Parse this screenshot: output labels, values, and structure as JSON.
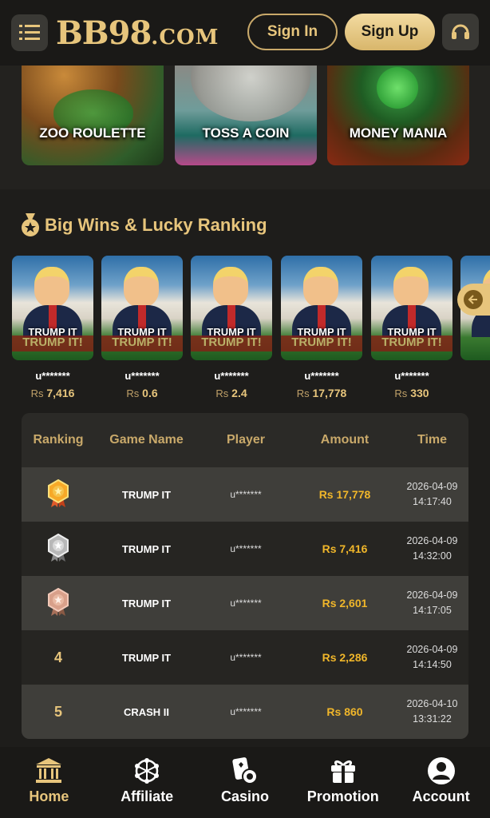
{
  "header": {
    "logo_main": "BB98",
    "logo_suffix": ".COM",
    "signin_label": "Sign In",
    "signup_label": "Sign Up"
  },
  "games": [
    {
      "title": "ZOO ROULETTE"
    },
    {
      "title": "TOSS A COIN"
    },
    {
      "title": "MONEY MANIA"
    }
  ],
  "section": {
    "title": "Big Wins & Lucky Ranking"
  },
  "big_wins": [
    {
      "game": "TRUMP IT",
      "banner": "TRUMP IT!",
      "user": "u*******",
      "currency": "Rs",
      "amount": "7,416"
    },
    {
      "game": "TRUMP IT",
      "banner": "TRUMP IT!",
      "user": "u*******",
      "currency": "Rs",
      "amount": "0.6"
    },
    {
      "game": "TRUMP IT",
      "banner": "TRUMP IT!",
      "user": "u*******",
      "currency": "Rs",
      "amount": "2.4"
    },
    {
      "game": "TRUMP IT",
      "banner": "TRUMP IT!",
      "user": "u*******",
      "currency": "Rs",
      "amount": "17,778"
    },
    {
      "game": "TRUMP IT",
      "banner": "TRUMP IT!",
      "user": "u*******",
      "currency": "Rs",
      "amount": "330"
    }
  ],
  "ranking": {
    "headers": [
      "Ranking",
      "Game Name",
      "Player",
      "Amount",
      "Time"
    ],
    "rows": [
      {
        "rank": "1",
        "medal": "gold",
        "game": "TRUMP IT",
        "player": "u*******",
        "amount": "Rs 17,778",
        "date": "2026-04-09",
        "time": "14:17:40"
      },
      {
        "rank": "2",
        "medal": "silver",
        "game": "TRUMP IT",
        "player": "u*******",
        "amount": "Rs 7,416",
        "date": "2026-04-09",
        "time": "14:32:00"
      },
      {
        "rank": "3",
        "medal": "bronze",
        "game": "TRUMP IT",
        "player": "u*******",
        "amount": "Rs 2,601",
        "date": "2026-04-09",
        "time": "14:17:05"
      },
      {
        "rank": "4",
        "medal": "",
        "game": "TRUMP IT",
        "player": "u*******",
        "amount": "Rs 2,286",
        "date": "2026-04-09",
        "time": "14:14:50"
      },
      {
        "rank": "5",
        "medal": "",
        "game": "CRASH II",
        "player": "u*******",
        "amount": "Rs 860",
        "date": "2026-04-10",
        "time": "13:31:22"
      }
    ]
  },
  "bottom_nav": [
    {
      "label": "Home",
      "icon": "bank-icon",
      "active": true
    },
    {
      "label": "Affiliate",
      "icon": "network-icon",
      "active": false
    },
    {
      "label": "Casino",
      "icon": "cards-chip-icon",
      "active": false
    },
    {
      "label": "Promotion",
      "icon": "gift-icon",
      "active": false
    },
    {
      "label": "Account",
      "icon": "user-circle-icon",
      "active": false
    }
  ],
  "colors": {
    "accent_gold": "#e7c57c",
    "amount_gold": "#f0b62a",
    "background": "#1e1d1b"
  }
}
